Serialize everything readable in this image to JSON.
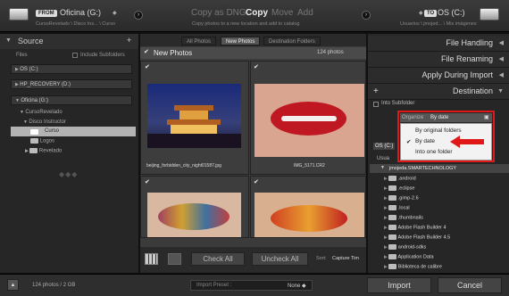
{
  "header": {
    "from_label": "FROM",
    "source_drive": "Oficina (G:)",
    "source_menu": "◆",
    "source_path": "CursoRevelado \\ Disco Ins... \\ Curso",
    "modes": [
      "Copy as DNG",
      "Copy",
      "Move",
      "Add"
    ],
    "active_mode": "Copy",
    "mode_hint": "Copy photos to a new location and add to catalog",
    "to_label": "TO",
    "dest_drive": "OS (C:)",
    "dest_menu": "◆",
    "dest_path": "Usuarios \\ jmojed... \\ Mis imágenes"
  },
  "source_panel": {
    "title": "Source",
    "plus": "+",
    "files_label": "Files",
    "include_subfolders": "Include Subfolders",
    "drives": [
      "OS (C:)",
      "HP_RECOVERY (D:)",
      "Oficina (G:)"
    ],
    "tree": [
      "CursoRevelado",
      "Disco Instructor",
      "Curso",
      "Logos",
      "Revelado"
    ]
  },
  "tabs": [
    "All Photos",
    "New Photos",
    "Destination Folders"
  ],
  "active_tab": "New Photos",
  "grid": {
    "group_title": "New Photos",
    "count": "124 photos",
    "captions": [
      "beijing_forbidden_city_night01587.jpg",
      "IMG_5171.CR2"
    ],
    "check_all": "Check All",
    "uncheck_all": "Uncheck All",
    "sort_label": "Sort:",
    "sort_value": "Capture Tim"
  },
  "right_panel": {
    "sections": [
      "File Handling",
      "File Renaming",
      "Apply During Import",
      "Destination"
    ],
    "into_subfolder": "Into Subfolder",
    "organize_label": "Organize",
    "organize_value": "By date",
    "options": [
      "By original folders",
      "By date",
      "Into one folder"
    ],
    "selected_option": "By date",
    "drive": "OS (C:)",
    "users_label": "Usua",
    "user_folder": "jmojeda.SMARTECHNOLOGY",
    "folders": [
      ".android",
      ".eclipse",
      ".gimp-2.6",
      ".local",
      ".thumbnails",
      "Adobe Flash Builder 4",
      "Adobe Flash Builder 4.5",
      "android-sdks",
      "Application Data",
      "Biblioteca de calibre"
    ]
  },
  "footer": {
    "status": "124 photos / 2 GB",
    "preset_label": "Import Preset :",
    "preset_value": "None ◆",
    "import": "Import",
    "cancel": "Cancel"
  },
  "colors": {
    "highlight": "#e01818",
    "background": "#111111"
  }
}
